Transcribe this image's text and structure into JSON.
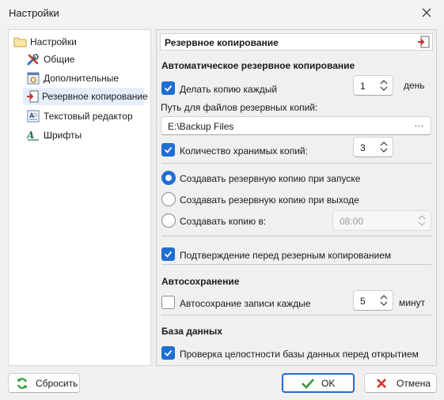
{
  "window": {
    "title": "Настройки"
  },
  "tree": {
    "root": {
      "label": "Настройки",
      "icon": "folder-icon"
    },
    "items": [
      {
        "label": "Общие",
        "icon": "tools-icon"
      },
      {
        "label": "Дополнительные",
        "icon": "settings-window-icon"
      },
      {
        "label": "Резервное копирование",
        "icon": "backup-icon",
        "selected": true
      },
      {
        "label": "Текстовый редактор",
        "icon": "text-editor-icon"
      },
      {
        "label": "Шрифты",
        "icon": "font-icon"
      }
    ]
  },
  "panel": {
    "title": "Резервное копирование",
    "auto_backup": {
      "heading": "Автоматическое резервное копирование",
      "every_label": "Делать копию каждый",
      "every_checked": true,
      "every_value": "1",
      "every_unit": "день",
      "path_label": "Путь для файлов резервных копий:",
      "path_value": "E:\\Backup Files",
      "path_browse": "...",
      "keep_label": "Количество хранимых копий:",
      "keep_checked": true,
      "keep_value": "3",
      "radio_startup": "Создавать резервную копию при запуске",
      "radio_exit": "Создавать резервную копию при выходе",
      "radio_at": "Создавать копию в:",
      "radio_selected": "startup",
      "time_value": "08:00",
      "confirm_label": "Подтверждение перед резерным копированием",
      "confirm_checked": true
    },
    "autosave": {
      "heading": "Автосохранение",
      "label": "Автосохрание записи каждые",
      "checked": false,
      "value": "5",
      "unit": "минут"
    },
    "database": {
      "heading": "База данных",
      "label": "Проверка целостности базы данных перед открытием",
      "checked": true
    }
  },
  "buttons": {
    "reset": "Сбросить",
    "ok": "OK",
    "cancel": "Отмена"
  },
  "colors": {
    "accent": "#1f6ed4",
    "selection": "#e5eefb"
  }
}
